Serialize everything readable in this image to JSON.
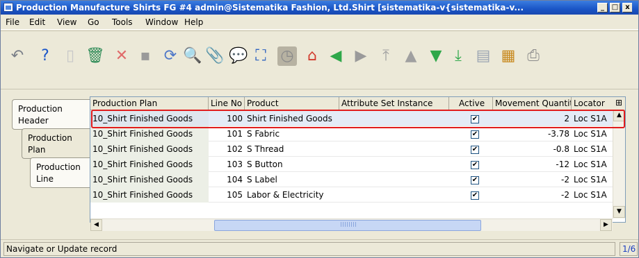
{
  "window": {
    "title": "Production Manufacture Shirts FG #4  admin@Sistematika Fashion, Ltd.Shirt [sistematika-v{sistematika-v...",
    "controls": [
      "_",
      "□",
      "x"
    ]
  },
  "menu": [
    "File",
    "Edit",
    "View",
    "Go",
    "Tools",
    "Window",
    "Help"
  ],
  "toolbar": [
    {
      "name": "undo-icon",
      "glyph": "↶",
      "color": "#7a7f88"
    },
    {
      "name": "help-icon",
      "glyph": "?",
      "color": "#1b56c9"
    },
    {
      "name": "new-record-icon",
      "glyph": "▯",
      "color": "#c8c8c8"
    },
    {
      "name": "delete-icon",
      "glyph": "🗑",
      "color": "#2e8b57"
    },
    {
      "name": "delete-selection-icon",
      "glyph": "✕",
      "color": "#e06a6a"
    },
    {
      "name": "save-icon",
      "glyph": "▪",
      "color": "#9a9a9a"
    },
    {
      "name": "refresh-icon",
      "glyph": "⟳",
      "color": "#4e77c8"
    },
    {
      "name": "find-icon",
      "glyph": "🔍",
      "color": "#6b6b6b"
    },
    {
      "name": "attachment-icon",
      "glyph": "📎",
      "color": "#7a7a7a"
    },
    {
      "name": "chat-icon",
      "glyph": "💬",
      "color": "#8b8b8b"
    },
    {
      "name": "grid-toggle-icon",
      "glyph": "⛶",
      "color": "#2f63c0"
    },
    {
      "name": "history-icon",
      "glyph": "◷",
      "color": "#8a8a8a"
    },
    {
      "name": "home-icon",
      "glyph": "⌂",
      "color": "#d23b2d"
    },
    {
      "name": "previous-window-icon",
      "glyph": "◀",
      "color": "#2fa84a"
    },
    {
      "name": "next-window-icon",
      "glyph": "▶",
      "color": "#9a9a9a"
    },
    {
      "name": "first-record-icon",
      "glyph": "⤒",
      "color": "#a0a0a0"
    },
    {
      "name": "previous-record-icon",
      "glyph": "▲",
      "color": "#a0a0a0"
    },
    {
      "name": "next-record-icon",
      "glyph": "▼",
      "color": "#2fa84a"
    },
    {
      "name": "last-record-icon",
      "glyph": "⤓",
      "color": "#2fa84a"
    },
    {
      "name": "report-icon",
      "glyph": "▤",
      "color": "#9aa4b2"
    },
    {
      "name": "archive-icon",
      "glyph": "▦",
      "color": "#c8891e"
    },
    {
      "name": "print-icon",
      "glyph": "⎙",
      "color": "#8a8a8a"
    }
  ],
  "tabs": [
    {
      "label": "Production Header"
    },
    {
      "label": "Production Plan"
    },
    {
      "label": "Production Line"
    }
  ],
  "grid": {
    "columns": [
      "Production Plan",
      "Line No",
      "Product",
      "Attribute Set Instance",
      "Active",
      "Movement Quantity",
      "Locator"
    ],
    "rows": [
      {
        "plan": "10_Shirt Finished Goods",
        "line": "100",
        "product": "Shirt Finished Goods",
        "asi": "",
        "active": true,
        "qty": "2",
        "locator": "Loc S1A"
      },
      {
        "plan": "10_Shirt Finished Goods",
        "line": "101",
        "product": "S Fabric",
        "asi": "",
        "active": true,
        "qty": "-3.78",
        "locator": "Loc S1A"
      },
      {
        "plan": "10_Shirt Finished Goods",
        "line": "102",
        "product": "S Thread",
        "asi": "",
        "active": true,
        "qty": "-0.8",
        "locator": "Loc S1A"
      },
      {
        "plan": "10_Shirt Finished Goods",
        "line": "103",
        "product": "S Button",
        "asi": "",
        "active": true,
        "qty": "-12",
        "locator": "Loc S1A"
      },
      {
        "plan": "10_Shirt Finished Goods",
        "line": "104",
        "product": "S Label",
        "asi": "",
        "active": true,
        "qty": "-2",
        "locator": "Loc S1A"
      },
      {
        "plan": "10_Shirt Finished Goods",
        "line": "105",
        "product": "Labor & Electricity",
        "asi": "",
        "active": true,
        "qty": "-2",
        "locator": "Loc S1A"
      }
    ]
  },
  "status": {
    "message": "Navigate or Update record",
    "record_count": "1/6"
  }
}
